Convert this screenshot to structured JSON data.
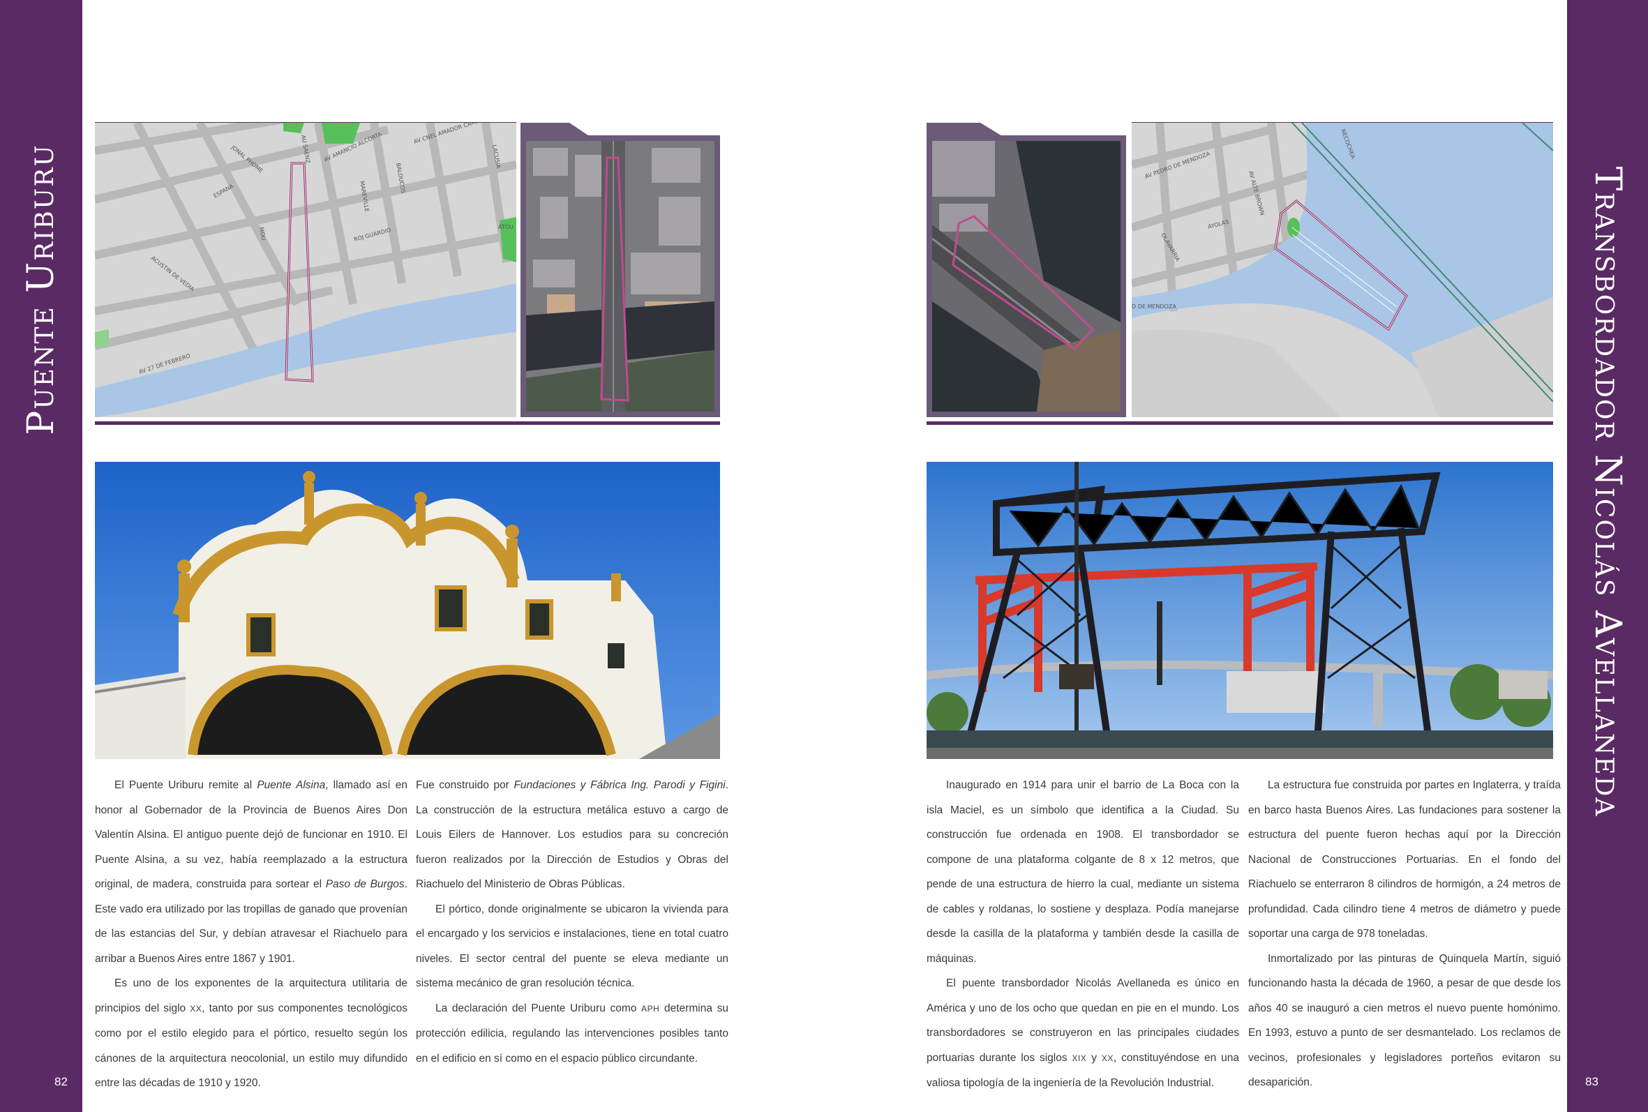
{
  "left_page": {
    "title": "Puente Uriburu",
    "page_number": "82",
    "map_labels": {
      "street_1": "JONAL PHOME",
      "street_2": "AU SAENZ",
      "street_3": "AV AMANCIO ALCORTA",
      "street_4": "BALOUCOS",
      "street_5": "AV CNEL AMADOR CAMPOS",
      "street_6": "LACUSIA",
      "street_7": "MAREVILLE",
      "street_8": "ESPANA",
      "street_9": "MOU",
      "street_10": "ACUSTIN DE VEDIA",
      "street_11": "ROJ GUARDIO",
      "street_12": "AV 27 DE FEBRERO",
      "street_13": "ATOU"
    },
    "col1": {
      "p1_a": "El Puente Uriburu remite al ",
      "p1_em1": "Puente Alsina",
      "p1_b": ", llamado así en honor al Gobernador de la Provincia de Buenos Aires Don Valentín Alsina. El antiguo puente dejó de funcionar en 1910. El Puente Alsina, a su vez, había reemplazado a la estructura original, de madera, construida para sortear el ",
      "p1_em2": "Paso de Burgos",
      "p1_c": ". Este vado era utilizado por las tropillas de ganado que provenían de las estancias del Sur, y debían atravesar el Riachuelo para arribar a Buenos Aires entre 1867 y 1901.",
      "p2_a": "Es uno de los exponentes de la arquitectura utilitaria de principios del siglo ",
      "p2_sc": "XX",
      "p2_b": ", tanto por sus componentes tecnológicos como por el estilo elegido para el pórtico, resuelto según los cánones de la arquitectura neocolonial, un estilo muy difundido entre las décadas de 1910 y 1920."
    },
    "col2": {
      "p1_a": "Fue construido por ",
      "p1_em": "Fundaciones y Fábrica Ing. Parodi y Figini",
      "p1_b": ". La construcción de la estructura metálica estuvo a cargo de Louis Eilers de Hannover. Los estudios para su concreción fueron realizados por la Dirección de Estudios y Obras del Riachuelo del Ministerio de Obras Públicas.",
      "p2": "El pórtico, donde originalmente se ubicaron la vivienda para el encargado y los servicios e instalaciones, tiene en total cuatro niveles. El sector central del puente se eleva mediante un sistema mecánico de gran resolución técnica.",
      "p3_a": "La declaración del Puente Uriburu como ",
      "p3_sc": "APH",
      "p3_b": " determina su protección edilicia, regulando las intervenciones posibles tanto en el edificio en sí como en el espacio público circundante."
    }
  },
  "right_page": {
    "title": "Transbordador Nicolás Avellaneda",
    "page_number": "83",
    "map_labels": {
      "street_1": "AV PEDRO DE MENDOZA",
      "street_2": "AV ALTE BROWN",
      "street_3": "OLAVARRIA",
      "street_4": "AYOLAS",
      "street_5": "D DE MENDOZA",
      "street_6": "NECOCHEA"
    },
    "col1": {
      "p1": "Inaugurado en 1914 para unir el barrio de La Boca con la isla Maciel, es un símbolo que identifica a la Ciudad. Su construcción fue ordenada en 1908. El transbordador se compone de una plataforma colgante de 8 x 12 metros, que pende de una estructura de hierro la cual, mediante un sistema de cables y roldanas, lo sostiene y desplaza. Podía manejarse desde la casilla de la plataforma y también desde la casilla de máquinas.",
      "p2_a": "El puente transbordador Nicolás Avellaneda es único en América y uno de los ocho que quedan en pie en el mundo. Los transbordadores se construyeron en las principales ciudades portuarias durante los siglos ",
      "p2_sc1": "XIX",
      "p2_b": " y ",
      "p2_sc2": "XX",
      "p2_c": ", constituyéndose en una valiosa tipología de la ingeniería de la Revolución Industrial."
    },
    "col2": {
      "p1": "La estructura fue construida por partes en Inglaterra, y traída en barco hasta Buenos Aires. Las fundaciones para sostener la estructura del puente fueron hechas aquí por la Dirección Nacional de Construcciones Portuarias. En el fondo del Riachuelo se enterraron 8 cilindros de hormigón, a 24 metros de profundidad. Cada cilindro tiene 4 metros de diámetro y puede soportar una carga de 978 toneladas.",
      "p2": "Inmortalizado por las pinturas de Quinquela Martín, siguió funcionando hasta la década de 1960, a pesar de que desde los años 40 se inauguró a cien metros el nuevo puente homónimo. En 1993, estuvo a punto de ser desmantelado. Los reclamos de vecinos, profesionales y legisladores porteños evitaron su desaparición."
    }
  },
  "colors": {
    "purple": "#5a2a64",
    "frame": "#6b5a78",
    "map_bg": "#cfcfcf",
    "map_road": "#b3b3b3",
    "water": "#a9c6e6",
    "park": "#58c05a",
    "outline": "#8a1f5a"
  }
}
